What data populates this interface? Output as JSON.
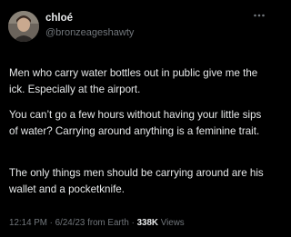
{
  "author": {
    "display_name": "chloé",
    "handle": "@bronzeageshawty"
  },
  "tweet": {
    "paragraphs": [
      "Men who carry water bottles out in public give me the ick. Especially at the airport.",
      "You can’t go a few hours without having your little sips of water? Carrying around anything is a feminine trait.",
      "The only things men should be carrying around are his wallet and a pocketknife."
    ]
  },
  "meta": {
    "time": "12:14 PM",
    "separator": "·",
    "date": "6/24/23",
    "source": "from Earth",
    "views_count": "338K",
    "views_label": "Views"
  },
  "icons": {
    "more": "more-horizontal-icon",
    "avatar": "avatar-photo"
  },
  "colors": {
    "background": "#000000",
    "primary_text": "#e7e9ea",
    "secondary_text": "#71767b"
  }
}
